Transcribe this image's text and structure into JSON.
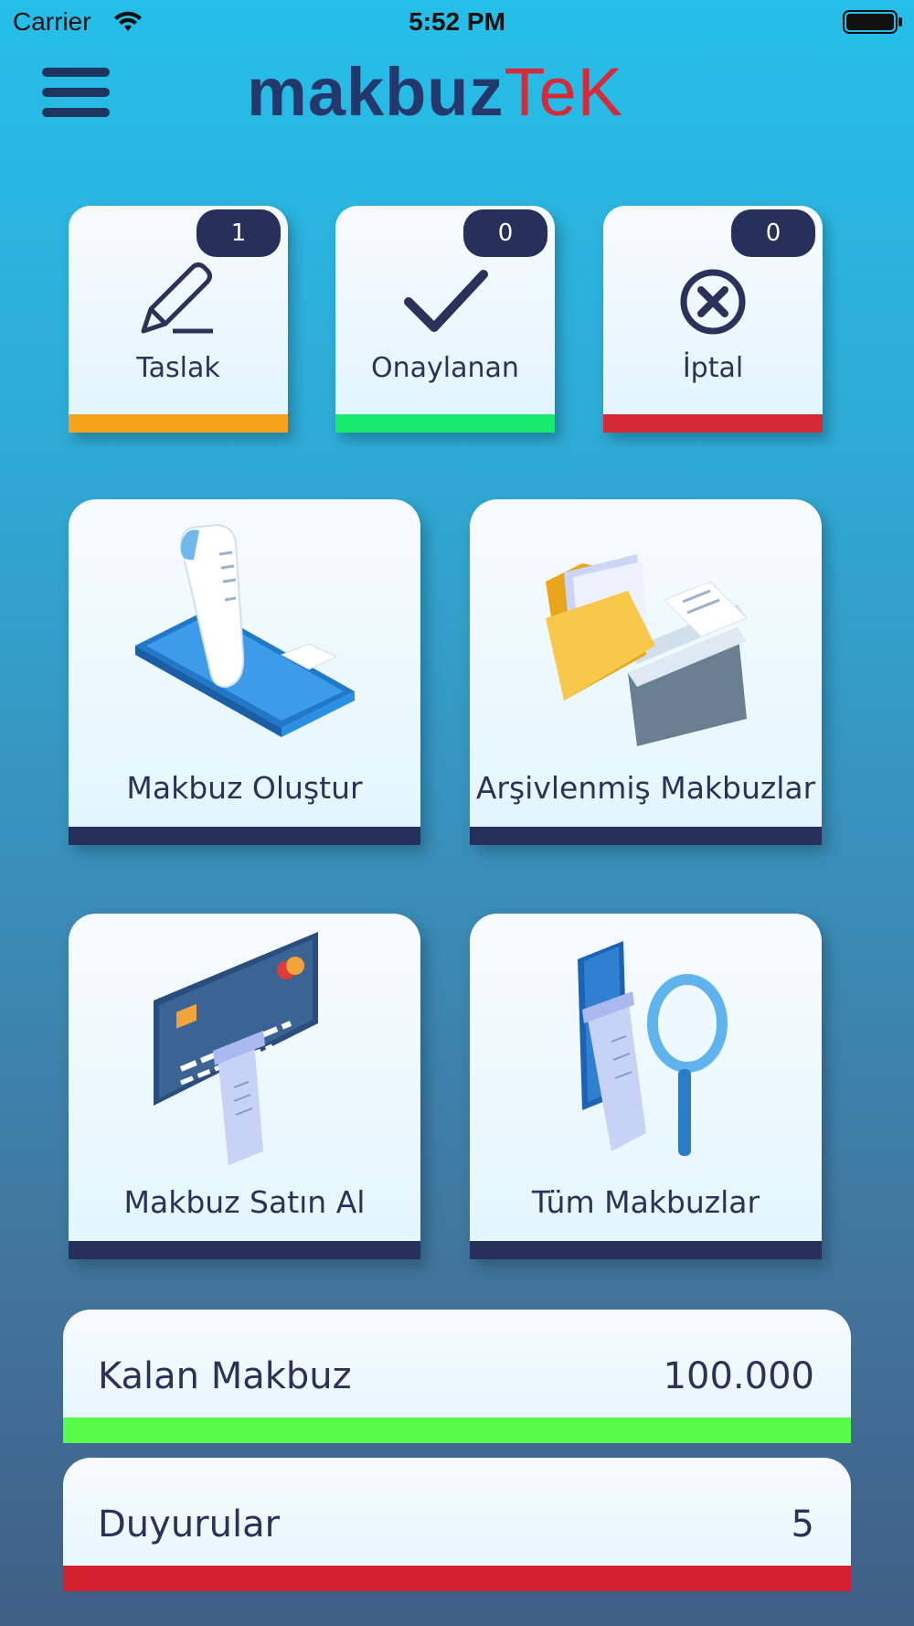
{
  "status_bar": {
    "carrier": "Carrier",
    "time": "5:52 PM"
  },
  "header": {
    "logo_part1": "makbuz",
    "logo_part2": "TeK"
  },
  "status_cards": [
    {
      "label": "Taslak",
      "count": "1",
      "icon": "pencil-icon",
      "color": "#f4a31a"
    },
    {
      "label": "Onaylanan",
      "count": "0",
      "icon": "checkmark-icon",
      "color": "#17ea6e"
    },
    {
      "label": "İptal",
      "count": "0",
      "icon": "cancel-circle-icon",
      "color": "#d42a37"
    }
  ],
  "action_cards": [
    {
      "label": "Makbuz Oluştur",
      "icon": "receipt-phone-icon"
    },
    {
      "label": "Arşivlenmiş Makbuzlar",
      "icon": "archive-folder-icon"
    },
    {
      "label": "Makbuz Satın Al",
      "icon": "credit-card-receipt-icon"
    },
    {
      "label": "Tüm Makbuzlar",
      "icon": "search-receipts-icon"
    }
  ],
  "info_rows": [
    {
      "label": "Kalan Makbuz",
      "value": "100.000",
      "color": "#58fb4a"
    },
    {
      "label": "Duyurular",
      "value": "5",
      "color": "#d5202f"
    }
  ],
  "colors": {
    "navy": "#27305a",
    "background_top": "#25bfe9",
    "background_bottom": "#3f5f86"
  }
}
